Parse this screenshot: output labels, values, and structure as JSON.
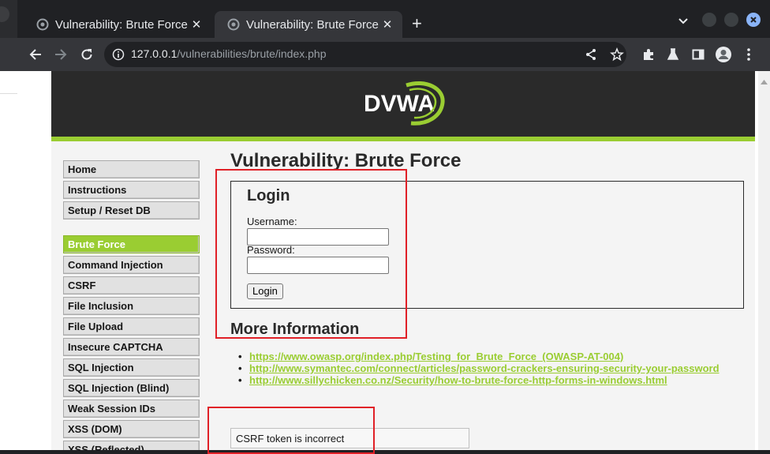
{
  "browser": {
    "tabs": [
      {
        "title": "Vulnerability: Brute Force :: Dam",
        "active": false
      },
      {
        "title": "Vulnerability: Brute Force :: Dam",
        "active": true
      }
    ],
    "new_tab_icon": "plus-icon",
    "address": {
      "host": "127.0.0.1",
      "path": "/vulnerabilities/brute/index.php"
    },
    "toolbar_icons": [
      "back-icon",
      "forward-icon",
      "reload-icon",
      "share-icon",
      "star-icon",
      "extensions-icon",
      "labs-icon",
      "sidepanel-icon",
      "profile-icon",
      "menu-icon"
    ]
  },
  "page": {
    "logo_text": "DVWA",
    "menu": [
      {
        "label": "Home",
        "selected": false
      },
      {
        "label": "Instructions",
        "selected": false
      },
      {
        "label": "Setup / Reset DB",
        "selected": false
      },
      {
        "label": "Brute Force",
        "selected": true
      },
      {
        "label": "Command Injection",
        "selected": false
      },
      {
        "label": "CSRF",
        "selected": false
      },
      {
        "label": "File Inclusion",
        "selected": false
      },
      {
        "label": "File Upload",
        "selected": false
      },
      {
        "label": "Insecure CAPTCHA",
        "selected": false
      },
      {
        "label": "SQL Injection",
        "selected": false
      },
      {
        "label": "SQL Injection (Blind)",
        "selected": false
      },
      {
        "label": "Weak Session IDs",
        "selected": false
      },
      {
        "label": "XSS (DOM)",
        "selected": false
      },
      {
        "label": "XSS (Reflected)",
        "selected": false
      }
    ],
    "title": "Vulnerability: Brute Force",
    "login": {
      "heading": "Login",
      "username_label": "Username:",
      "username_value": "",
      "password_label": "Password:",
      "password_value": "",
      "button_label": "Login"
    },
    "more_info_heading": "More Information",
    "links": [
      "https://www.owasp.org/index.php/Testing_for_Brute_Force_(OWASP-AT-004)",
      "http://www.symantec.com/connect/articles/password-crackers-ensuring-security-your-password",
      "http://www.sillychicken.co.nz/Security/how-to-brute-force-http-forms-in-windows.html"
    ],
    "message": "CSRF token is incorrect"
  },
  "colors": {
    "accent_green": "#9acd32",
    "header_dark": "#2a2a2a",
    "annotation_red": "#e02027",
    "chrome_dark": "#202124"
  }
}
